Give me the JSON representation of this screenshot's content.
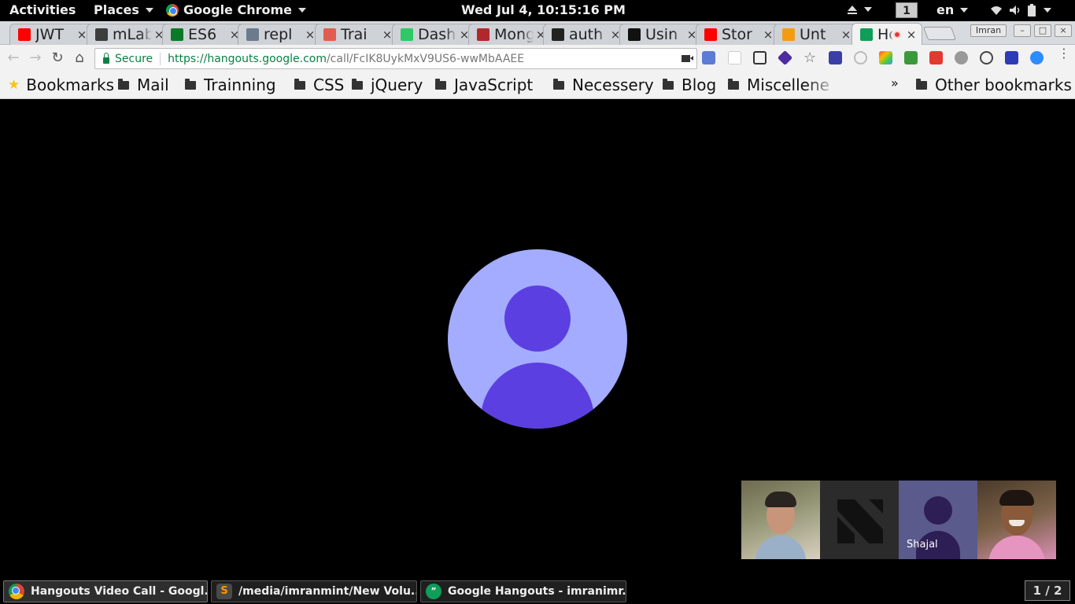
{
  "topbar": {
    "activities": "Activities",
    "places": "Places",
    "app_name": "Google Chrome",
    "clock": "Wed Jul  4, 10:15:16 PM",
    "workspace": "1",
    "language": "en"
  },
  "tabs": [
    {
      "title": "JWT",
      "favicon": "youtube-icon",
      "color": "#ff0000"
    },
    {
      "title": "mLab",
      "favicon": "mlab-icon",
      "color": "#3d3d3d"
    },
    {
      "title": "ES6",
      "favicon": "es6-icon",
      "color": "#0a7a27"
    },
    {
      "title": "repl",
      "favicon": "repl-icon",
      "color": "#6b7a8c"
    },
    {
      "title": "Trai",
      "favicon": "training-icon",
      "color": "#e25d4f"
    },
    {
      "title": "Dash",
      "favicon": "hackerrank-icon",
      "color": "#2ec866"
    },
    {
      "title": "Mong",
      "favicon": "mongo-icon",
      "color": "#b1282c"
    },
    {
      "title": "auth",
      "favicon": "github-icon",
      "color": "#222222"
    },
    {
      "title": "Usin",
      "favicon": "dev-icon",
      "color": "#111111"
    },
    {
      "title": "Stor",
      "favicon": "youtube-icon",
      "color": "#ff0000"
    },
    {
      "title": "Unt",
      "favicon": "untitled-icon",
      "color": "#f39c12"
    },
    {
      "title": "Ho",
      "favicon": "hangouts-icon",
      "color": "#0f9d58",
      "active": true
    }
  ],
  "window": {
    "user": "Imran"
  },
  "address_bar": {
    "secure_label": "Secure",
    "url_scheme_host": "https://hangouts.google.com",
    "url_path": "/call/FcIK8UykMxV9US6-wwMbAAEE"
  },
  "bookmarks": {
    "items": [
      "Bookmarks",
      "Mail",
      "Trainning",
      "CSS",
      "jQuery",
      "JavaScript",
      "Necessery",
      "Blog",
      "Miscellene"
    ],
    "overflow": "»",
    "other": "Other bookmarks"
  },
  "call": {
    "participants": [
      {
        "name": "",
        "kind": "photo"
      },
      {
        "name": "",
        "kind": "logo"
      },
      {
        "name": "Shajal",
        "kind": "placeholder-avatar"
      },
      {
        "name": "",
        "kind": "photo"
      }
    ],
    "colors": {
      "avatar_bg": "#a3acff",
      "avatar_fg": "#5c3fe0"
    }
  },
  "taskbar": {
    "tasks": [
      {
        "label": "Hangouts Video Call - Googl...",
        "icon": "chrome-icon"
      },
      {
        "label": "/media/imranmint/New Volu...",
        "icon": "sublime-icon"
      },
      {
        "label": "Google Hangouts - imranimr...",
        "icon": "hangouts-icon"
      }
    ],
    "workspace_indicator": "1 / 2"
  }
}
